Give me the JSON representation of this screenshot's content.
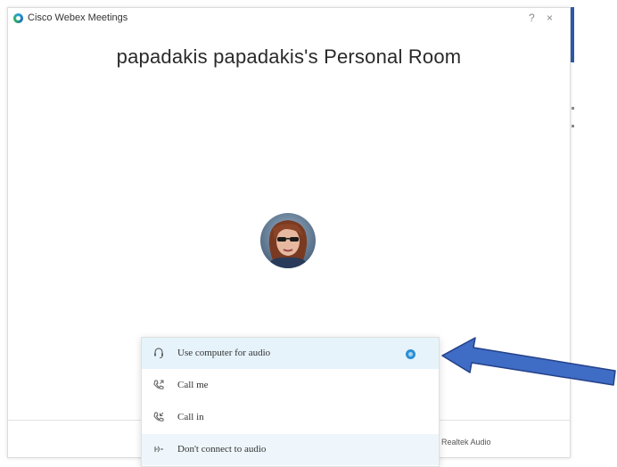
{
  "window": {
    "app_title": "Cisco Webex Meetings",
    "help_icon": "?",
    "close_icon": "×"
  },
  "room": {
    "title": "papadakis papadakis's Personal Room"
  },
  "audio_menu": {
    "items": [
      {
        "label": "Use computer for audio",
        "icon": "headset-icon",
        "selected": true
      },
      {
        "label": "Call me",
        "icon": "phone-outgoing-icon",
        "selected": false
      },
      {
        "label": "Call in",
        "icon": "phone-incoming-icon",
        "selected": false
      },
      {
        "label": "Don't connect to audio",
        "icon": "audio-off-icon",
        "selected": false
      }
    ]
  },
  "footer": {
    "speaker_label": "Realtek Audio"
  },
  "colors": {
    "accent": "#2a8fd6",
    "selected_bg": "#e6f3fb",
    "arrow_fill": "#3f6cc4",
    "arrow_stroke": "#24418a"
  }
}
